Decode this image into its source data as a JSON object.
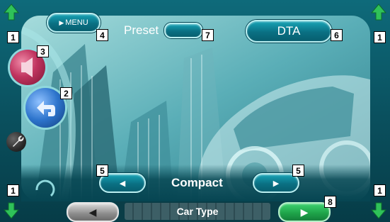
{
  "header": {
    "menu_label": "MENU",
    "preset_label": "Preset",
    "dta_label": "DTA"
  },
  "selector": {
    "value": "Compact"
  },
  "footer": {
    "car_type_label": "Car Type"
  },
  "callouts": {
    "c1": "1",
    "c2": "2",
    "c3": "3",
    "c4": "4",
    "c5": "5",
    "c6": "6",
    "c7": "7",
    "c8": "8"
  },
  "colors": {
    "frame": "#0e6a7a",
    "button_green": "#1fa54a",
    "audio_button": "#b52a55",
    "return_button": "#2a6fc4",
    "callout_bg": "#ffffff"
  },
  "icons": {
    "menu_arrow": "play-triangle-icon",
    "left_arrow": "triangle-left-icon",
    "right_arrow": "triangle-right-icon",
    "return": "return-arrow-icon",
    "audio": "speaker-icon",
    "setup": "wrench-icon",
    "up": "up-arrow-icon",
    "down": "down-arrow-icon"
  }
}
